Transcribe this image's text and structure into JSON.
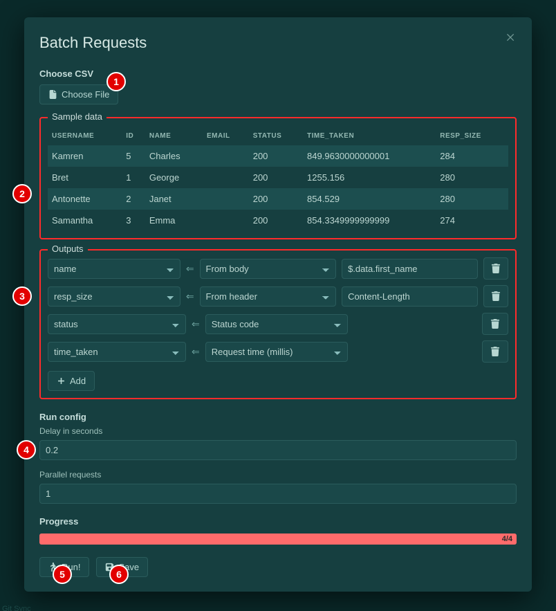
{
  "modal": {
    "title": "Batch Requests",
    "choose_csv_label": "Choose CSV",
    "choose_file_btn": "Choose File"
  },
  "sample": {
    "legend": "Sample data",
    "headers": [
      "USERNAME",
      "ID",
      "NAME",
      "EMAIL",
      "STATUS",
      "TIME_TAKEN",
      "RESP_SIZE"
    ],
    "rows": [
      {
        "username": "Kamren",
        "id": "5",
        "name": "Charles",
        "email": "",
        "status": "200",
        "time_taken": "849.9630000000001",
        "resp_size": "284"
      },
      {
        "username": "Bret",
        "id": "1",
        "name": "George",
        "email": "",
        "status": "200",
        "time_taken": "1255.156",
        "resp_size": "280"
      },
      {
        "username": "Antonette",
        "id": "2",
        "name": "Janet",
        "email": "",
        "status": "200",
        "time_taken": "854.529",
        "resp_size": "280"
      },
      {
        "username": "Samantha",
        "id": "3",
        "name": "Emma",
        "email": "",
        "status": "200",
        "time_taken": "854.3349999999999",
        "resp_size": "274"
      }
    ]
  },
  "outputs": {
    "legend": "Outputs",
    "add_btn": "Add",
    "rows": [
      {
        "name": "name",
        "source": "From body",
        "path": "$.data.first_name"
      },
      {
        "name": "resp_size",
        "source": "From header",
        "path": "Content-Length"
      },
      {
        "name": "status",
        "source": "Status code",
        "path": ""
      },
      {
        "name": "time_taken",
        "source": "Request time (millis)",
        "path": ""
      }
    ]
  },
  "run_config": {
    "legend": "Run config",
    "delay_label": "Delay in seconds",
    "delay_value": "0.2",
    "parallel_label": "Parallel requests",
    "parallel_value": "1"
  },
  "progress": {
    "label": "Progress",
    "text": "4/4",
    "percent": 100
  },
  "footer": {
    "run_btn": "Run!",
    "save_btn": "Save"
  },
  "annotations": [
    "1",
    "2",
    "3",
    "4",
    "5",
    "6"
  ],
  "bg_hints": {
    "sync": "Git Sync"
  }
}
